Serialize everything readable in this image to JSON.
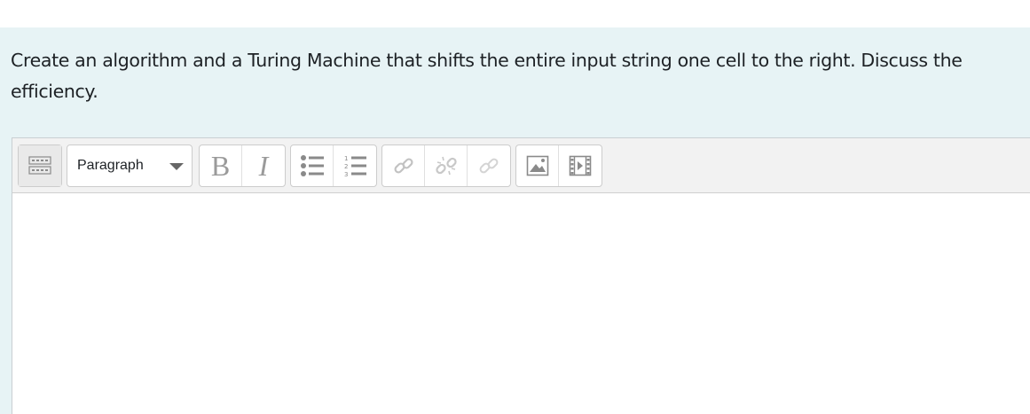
{
  "question": {
    "text": "Create an algorithm and a Turing Machine that shifts the entire input string one cell to the right. Discuss the efficiency."
  },
  "editor": {
    "toolbar": {
      "toggle_icon": "toolbar-toggle-icon",
      "paragraph_style": {
        "selected": "Paragraph"
      },
      "bold_label": "B",
      "italic_label": "I",
      "icons": {
        "unordered_list": "unordered-list-icon",
        "ordered_list": "ordered-list-icon",
        "link": "link-icon",
        "unlink": "unlink-icon",
        "anchor": "anchor-icon",
        "image": "image-icon",
        "media": "media-icon"
      }
    },
    "content_value": ""
  },
  "colors": {
    "panel_background": "#e7f3f5",
    "toolbar_background": "#f2f2f2",
    "icon_gray": "#9a9a9a"
  }
}
